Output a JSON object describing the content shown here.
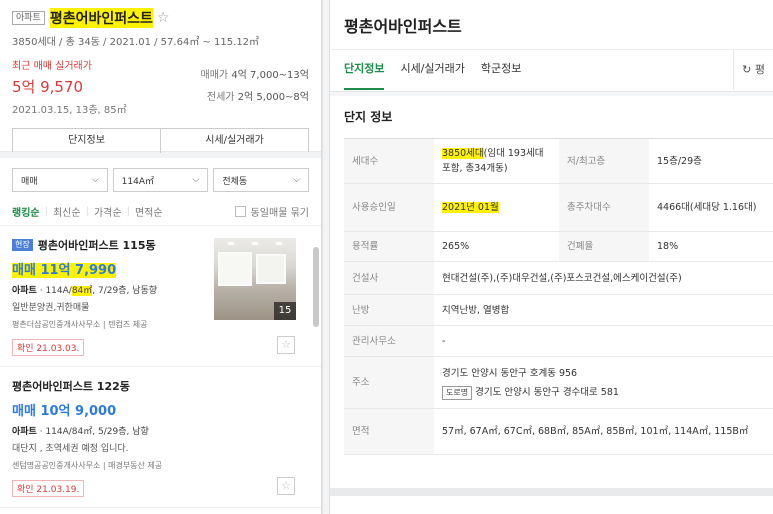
{
  "complex": {
    "tag": "아파트",
    "name": "평촌어바인퍼스트",
    "summary": "3850세대 / 총 34동 / 2021.01 / 57.64㎡ ~ 115.12㎡"
  },
  "recent": {
    "label": "최근 매매 실거래가",
    "price": "5억 9,570",
    "date": "2021.03.15, 13층, 85㎡",
    "sale_key": "매매가",
    "sale_val": "4억 7,000~13억",
    "jeonse_key": "전세가",
    "jeonse_val": "2억 5,000~8억"
  },
  "left_tabs": [
    "단지정보",
    "시세/실거래가"
  ],
  "filters": {
    "deal": "매매",
    "area": "114A㎡",
    "dong": "전체동"
  },
  "sort": {
    "options": [
      "랭킹순",
      "최신순",
      "가격순",
      "면적순"
    ],
    "same_listing": "동일매물 묶기"
  },
  "listings": [
    {
      "badge": "현장",
      "title": "평촌어바인퍼스트 115동",
      "price": "매매 11억 7,990",
      "spec_type": "아파트",
      "spec_pre": "114A/",
      "spec_hl": "84㎡",
      "spec_post": ", 7/29층, 남동향",
      "desc": "일반분양권,귀한매물",
      "source": "평촌더샵공인중개사사무소 | 텐컴즈 제공",
      "confirm": "확인 21.03.03.",
      "photo_count": "15"
    },
    {
      "title": "평촌어바인퍼스트 122동",
      "price": "매매 10억 9,000",
      "spec_type": "아파트",
      "spec": "114A/84㎡, 5/29층, 남향",
      "desc": "대단지 , 초역세권 예정 입니다.",
      "source": "센텀명공공인중개사사무소 | 매경부동산 제공",
      "confirm": "확인 21.03.19."
    }
  ],
  "detail": {
    "title": "평촌어바인퍼스트",
    "tabs": [
      "단지정보",
      "시세/실거래가",
      "학군정보"
    ],
    "refresh": "평",
    "section_title": "단지 정보",
    "rows": {
      "households_key": "세대수",
      "households_hl": "3850세대",
      "households_rest": "(임대 193세대 포함, 총34개동)",
      "floors_key": "저/최고층",
      "floors_val": "15층/29층",
      "approval_key": "사용승인일",
      "approval_val": "2021년 01월",
      "parking_key": "총주차대수",
      "parking_val": "4466대(세대당 1.16대)",
      "far_key": "용적률",
      "far_val": "265%",
      "bcr_key": "건폐율",
      "bcr_val": "18%",
      "builder_key": "건설사",
      "builder_val": "현대건설(주),(주)대우건설,(주)포스코건설,에스케이건설(주)",
      "heating_key": "난방",
      "heating_val": "지역난방, 열병합",
      "office_key": "관리사무소",
      "office_val": "-",
      "address_key": "주소",
      "address_val": "경기도 안양시 동안구 호계동 956",
      "road_tag": "도로명",
      "road_val": "경기도 안양시 동안구 경수대로 581",
      "area_key": "면적",
      "area_val": "57㎡, 67A㎡, 67C㎡, 68B㎡, 85A㎡, 85B㎡, 101㎡, 114A㎡, 115B㎡"
    }
  },
  "colors": {
    "accent_green": "#1d8d4a",
    "price_red": "#e03838",
    "price_blue": "#2e7be0",
    "highlight": "#fff200"
  }
}
